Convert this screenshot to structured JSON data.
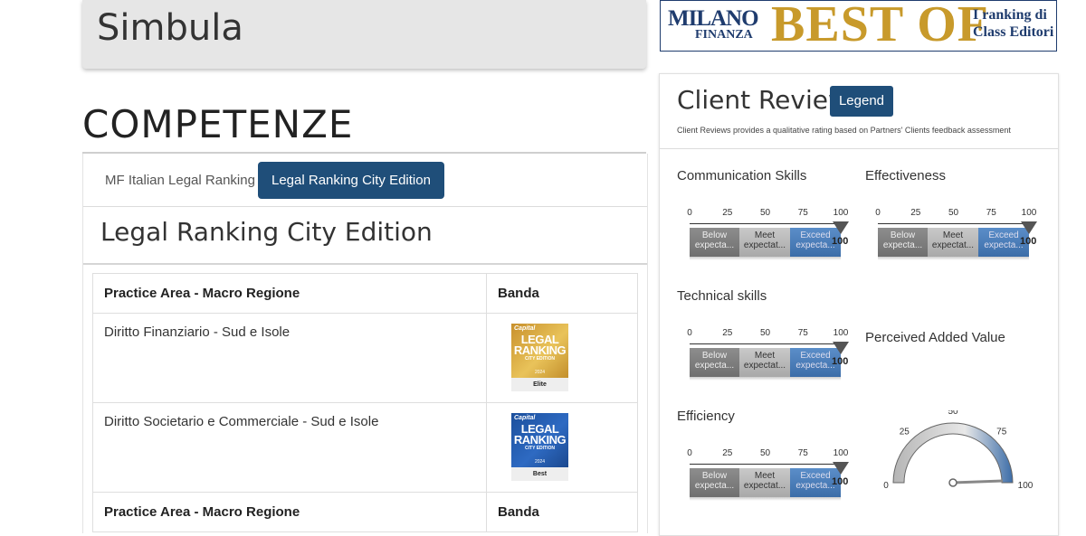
{
  "profile": {
    "name": "Simbula"
  },
  "section_title": "COMPETENZE",
  "tabs": [
    {
      "label": "MF Italian Legal Ranking",
      "active": false
    },
    {
      "label": "Legal Ranking City Edition",
      "active": true
    }
  ],
  "pane_title": "Legal Ranking City Edition",
  "table": {
    "headers": [
      "Practice Area - Macro Regione",
      "Banda"
    ],
    "rows": [
      {
        "area": "Diritto Finanziario - Sud e Isole",
        "badge": {
          "brand": "Capital",
          "line1": "LEGAL RANKING",
          "edition": "CITY EDITION",
          "year": "2024",
          "band": "Elite",
          "color": "#c8902c"
        }
      },
      {
        "area": "Diritto Societario e Commerciale - Sud e Isole",
        "badge": {
          "brand": "Capital",
          "line1": "LEGAL RANKING",
          "edition": "CITY EDITION",
          "year": "2024",
          "band": "Best",
          "color": "#1b4f9c"
        }
      }
    ],
    "footer_headers": [
      "Practice Area - Macro Regione",
      "Banda"
    ]
  },
  "banner": {
    "mf_line1": "MILANO",
    "mf_line2": "FINANZA",
    "big": "BEST OF",
    "ranking_line1": "I ranking di",
    "ranking_line2": "Class Editori"
  },
  "reviews": {
    "title": "Client Reviews",
    "legend_label": "Legend",
    "subtitle": "Client Reviews provides a qualitative rating based on Partners' Clients feedback assessment",
    "scale_ticks": [
      "0",
      "25",
      "50",
      "75",
      "100"
    ],
    "band_labels": [
      "Below expecta...",
      "Meet expectat...",
      "Exceed expecta..."
    ],
    "metrics": [
      {
        "label": "Communication Skills",
        "type": "bullet",
        "value": 100
      },
      {
        "label": "Effectiveness",
        "type": "bullet",
        "value": 100
      },
      {
        "label": "Technical skills",
        "type": "bullet",
        "value": 100
      },
      {
        "label": "Perceived Added Value",
        "type": "none"
      },
      {
        "label": "Efficiency",
        "type": "bullet",
        "value": 100
      },
      {
        "label": "",
        "type": "gauge",
        "value": 100,
        "ticks": [
          "0",
          "25",
          "50",
          "75",
          "100"
        ]
      }
    ]
  },
  "colors": {
    "accent": "#1f4e79",
    "gold": "#c89a2b",
    "banner_blue": "#1f3c6e"
  }
}
